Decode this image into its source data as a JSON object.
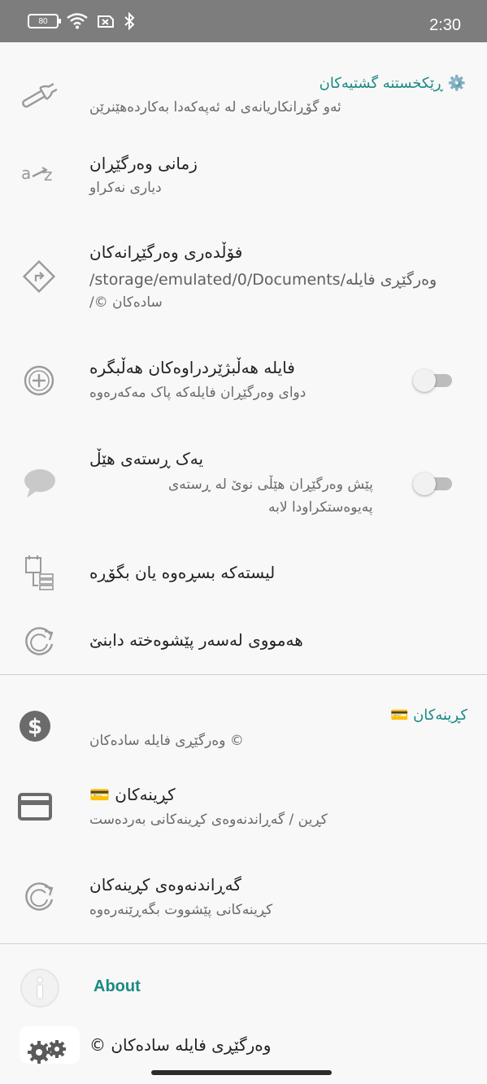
{
  "status": {
    "battery": "80",
    "time": "2:30"
  },
  "general": {
    "title": "⚙️ ڕێکخستنە گشتیەکان",
    "general_item": {
      "subtitle": "ئەو گۆڕانکاریانەی لە ئەپەکەدا بەکاردەهێنرێن"
    },
    "language": {
      "title": "زمانی وەرگێڕان",
      "subtitle": "دیاری نەکراو"
    },
    "folder": {
      "title": "فۆڵدەری وەرگێڕانەکان",
      "path_line1": "/storage/emulated/0/Documents/وەرگێڕی فایلە",
      "path_line2": "/© سادەکان"
    },
    "backup": {
      "title": "فایلە هەڵبژێردراوەکان هەڵبگرە",
      "subtitle": "دوای وەرگێڕان فایلەکە پاک مەکەرەوە",
      "enabled": false
    },
    "newline": {
      "title": "یەک ڕستەی هێڵ",
      "subtitle_line1": "پێش وەرگێڕان هێڵی نوێ لە ڕستەی",
      "subtitle_line2": "پەیوەستکراودا لابە",
      "enabled": false
    },
    "list": {
      "title": "لیستەکە بسڕەوە یان بگۆڕە"
    },
    "reset_all": {
      "title": "هەمووی لەسەر پێشوەختە دابنێ"
    }
  },
  "purchases": {
    "title": "کڕینەکان 💳",
    "donate": {
      "subtitle": "وەرگێڕی فایلە سادەکان ©"
    },
    "purchase": {
      "title": "کڕینەکان 💳",
      "subtitle": "کڕین / گەڕاندنەوەی کڕینەکانی بەردەست"
    },
    "restore": {
      "title": "گەڕاندنەوەی کڕینەکان",
      "subtitle": "کڕینەکانی پێشووت بگەڕێنەرەوە"
    }
  },
  "about": {
    "title": "About",
    "app": {
      "title": "وەرگێڕی فایلە سادەکان ©"
    }
  },
  "icons": {
    "wrench": "wrench-icon",
    "language": "language-az-icon",
    "folder": "directions-icon",
    "backup": "add-circle-icon",
    "newline": "speech-bubble-icon",
    "list": "list-edit-icon",
    "reset": "restore-icon",
    "dollar": "dollar-icon",
    "card": "credit-card-icon",
    "info": "info-icon",
    "gears": "gears-icon"
  },
  "colors": {
    "accent": "#1a8a84",
    "statusbar": "#7d7d7d",
    "background": "#f8f8f8"
  }
}
